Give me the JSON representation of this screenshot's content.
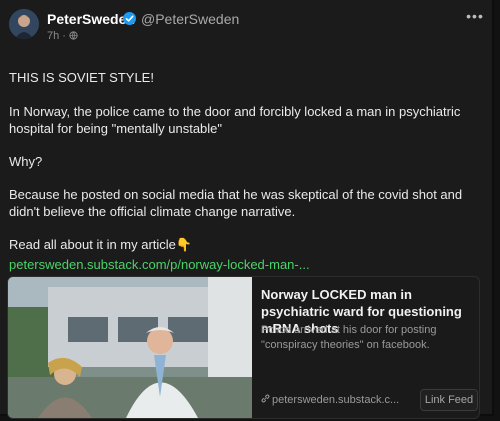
{
  "author": {
    "display_name": "PeterSweden",
    "handle": "@PeterSweden",
    "meta": "7h ·"
  },
  "post": {
    "p1": "THIS IS SOVIET STYLE!",
    "p2": "In Norway, the police came to the door and forcibly locked a man in psychiatric hospital for being \"mentally unstable\"",
    "p3": "Why?",
    "p4": "Because he posted on social media that he was skeptical of the covid shot and didn't believe the official climate change narrative.",
    "p5": "Read all about it in my article👇",
    "link": "petersweden.substack.com/p/norway-locked-man-..."
  },
  "preview": {
    "title": "Norway LOCKED man in psychiatric ward for questioning mRNA shots",
    "description": "Police arrived at his door for posting \"conspiracy theories\" on facebook.",
    "domain": "petersweden.substack.c...",
    "feed_button": "Link Feed"
  },
  "icons": {
    "verified": "verified-badge-icon",
    "more": "more-options-icon",
    "link": "link-icon"
  },
  "colors": {
    "background": "#1b1b1b",
    "link_green": "#4bd36a",
    "verified_blue": "#1d9bf0"
  }
}
